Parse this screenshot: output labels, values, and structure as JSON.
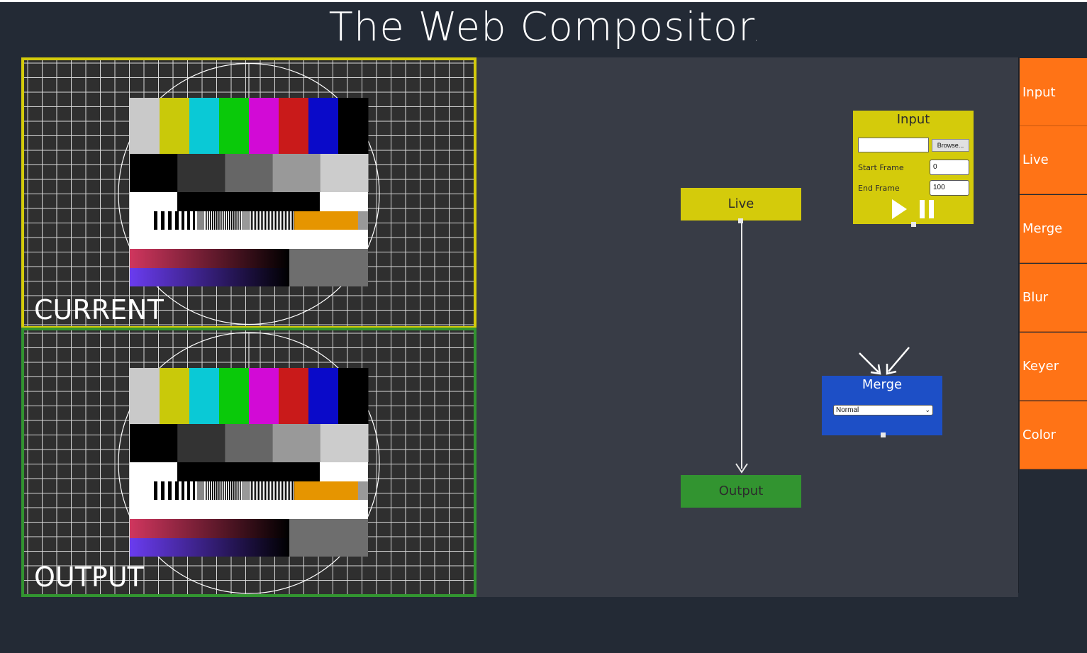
{
  "app": {
    "title": "The Web Compositor",
    "title_mark": ","
  },
  "viewers": {
    "current": {
      "label": "CURRENT",
      "border_color": "#d4cb0b"
    },
    "output": {
      "label": "OUTPUT",
      "border_color": "#329430"
    }
  },
  "test_pattern": {
    "color_bars": [
      "#c9c9c9",
      "#c9c90a",
      "#0ac9d6",
      "#0ac90a",
      "#d20ad6",
      "#c91a1a",
      "#0a0ac9",
      "#000000"
    ],
    "gray_steps": [
      "#000000",
      "#333333",
      "#666666",
      "#999999",
      "#cccccc"
    ],
    "orange": "#e69500"
  },
  "nodes": {
    "live": {
      "label": "Live",
      "color": "#d4cb0b"
    },
    "output": {
      "label": "Output",
      "color": "#329430"
    },
    "input": {
      "title": "Input",
      "browse_label": "Browse...",
      "start_frame_label": "Start Frame",
      "start_frame_value": "0",
      "end_frame_label": "End Frame",
      "end_frame_value": "100",
      "color": "#d4cb0b"
    },
    "merge": {
      "title": "Merge",
      "mode_value": "Normal",
      "color": "#1d4fc6"
    }
  },
  "sidebar": {
    "items": [
      {
        "label": "Input"
      },
      {
        "label": "Live"
      },
      {
        "label": "Merge"
      },
      {
        "label": "Blur"
      },
      {
        "label": "Keyer"
      },
      {
        "label": "Color"
      }
    ],
    "accent": "#ff7316"
  }
}
